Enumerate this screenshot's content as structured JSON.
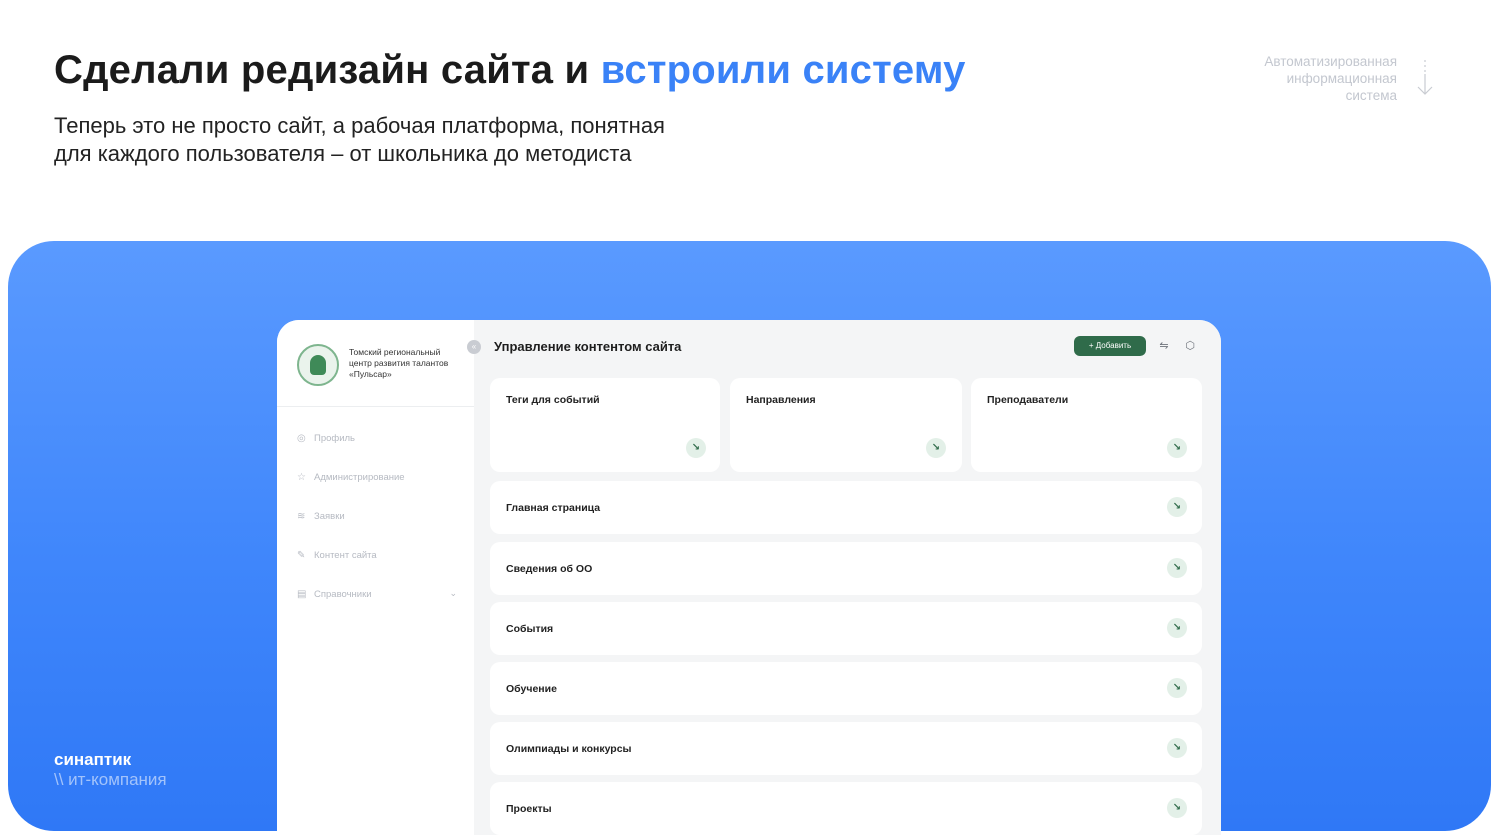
{
  "slide": {
    "title_main": "Сделали редизайн сайта и ",
    "title_accent": "встроили систему",
    "subtitle_line1": "Теперь это не просто сайт, а рабочая платформа, понятная",
    "subtitle_line2": "для каждого пользователя – от школьника до методиста",
    "corner_note_line1": "Автоматизированная",
    "corner_note_line2": "информационная",
    "corner_note_line3": "система",
    "brand_name": "синаптик",
    "brand_tagline": "\\\\ ит-компания",
    "accent_color": "#3a82f7"
  },
  "app": {
    "org_name": "Томский региональный центр развития талантов «Пульсар»",
    "nav": [
      {
        "label": "Профиль",
        "icon": "user-icon"
      },
      {
        "label": "Администрирование",
        "icon": "star-icon"
      },
      {
        "label": "Заявки",
        "icon": "layers-icon"
      },
      {
        "label": "Контент сайта",
        "icon": "edit-icon"
      },
      {
        "label": "Справочники",
        "icon": "book-icon",
        "has_submenu": true
      }
    ],
    "page_title": "Управление контентом сайта",
    "add_button": "+  Добавить",
    "tiles": [
      {
        "label": "Теги для событий"
      },
      {
        "label": "Направления"
      },
      {
        "label": "Преподаватели"
      }
    ],
    "rows": [
      {
        "label": "Главная страница"
      },
      {
        "label": "Сведения об ОО"
      },
      {
        "label": "События"
      },
      {
        "label": "Обучение"
      },
      {
        "label": "Олимпиады и конкурсы"
      },
      {
        "label": "Проекты"
      }
    ],
    "primary_color": "#2f6b4a"
  }
}
